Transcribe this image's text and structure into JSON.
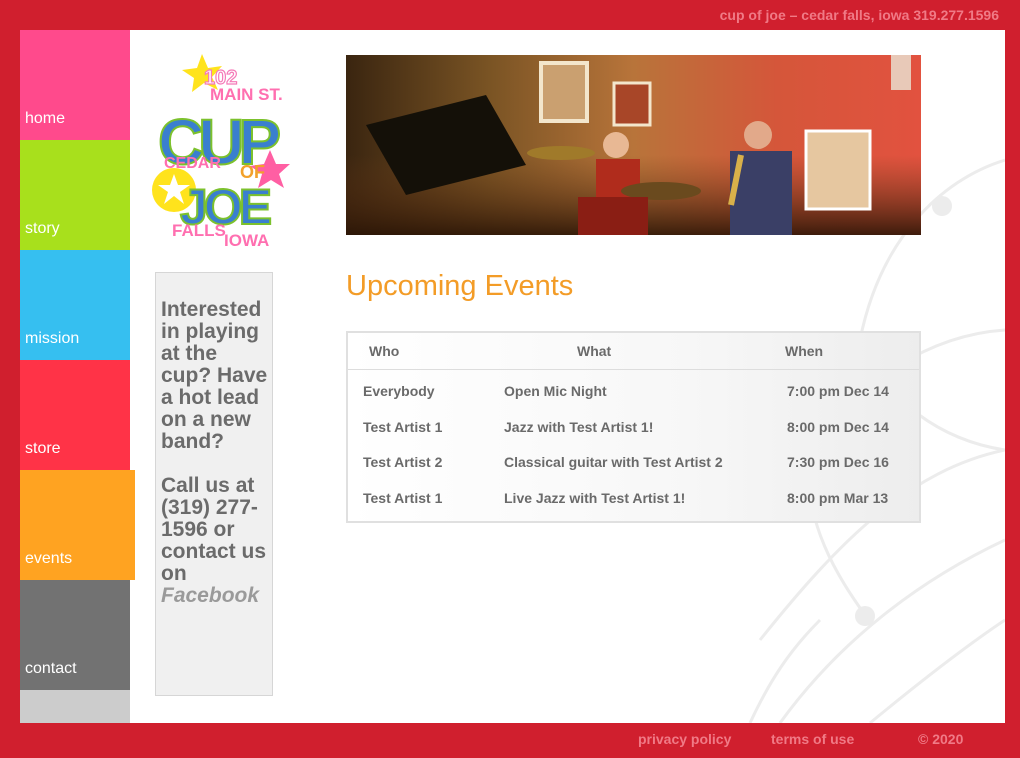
{
  "header": {
    "tagline": "cup of joe – cedar falls, iowa 319.277.1596"
  },
  "nav": {
    "items": [
      {
        "label": "home",
        "color": "#ff4a8c"
      },
      {
        "label": "story",
        "color": "#a8e01c"
      },
      {
        "label": "mission",
        "color": "#36bff0"
      },
      {
        "label": "store",
        "color": "#ff3347"
      },
      {
        "label": "events",
        "color": "#ffa321"
      },
      {
        "label": "contact",
        "color": "#727272"
      }
    ],
    "active": "events"
  },
  "logo": {
    "number": "102",
    "street": "MAIN ST.",
    "word_cup": "CUP",
    "word_of": "OF",
    "word_joe": "JOE",
    "city1": "CEDAR",
    "city2": "FALLS",
    "state": "IOWA"
  },
  "promo": {
    "text1": "Interested in playing at the cup? Have a hot lead on a new band?",
    "text2": "Call us at (319) 277-1596 or contact us on",
    "link": "Facebook"
  },
  "events": {
    "title": "Upcoming Events",
    "columns": [
      "Who",
      "What",
      "When"
    ],
    "rows": [
      {
        "who": "Everybody",
        "what": "Open Mic Night",
        "when": "7:00 pm Dec 14"
      },
      {
        "who": "Test Artist 1",
        "what": "Jazz with Test Artist 1!",
        "when": "8:00 pm Dec 14"
      },
      {
        "who": "Test Artist 2",
        "what": "Classical guitar with Test Artist 2",
        "when": "7:30 pm Dec 16"
      },
      {
        "who": "Test Artist 1",
        "what": "Live Jazz with Test Artist 1!",
        "when": "8:00 pm Mar 13"
      }
    ]
  },
  "footer": {
    "privacy": "privacy policy",
    "terms": "terms of use",
    "copyright": "© 2020"
  },
  "colors": {
    "brand_red": "#d01f2e",
    "heading_orange": "#f39c27",
    "footer_pink": "#f07a86"
  }
}
